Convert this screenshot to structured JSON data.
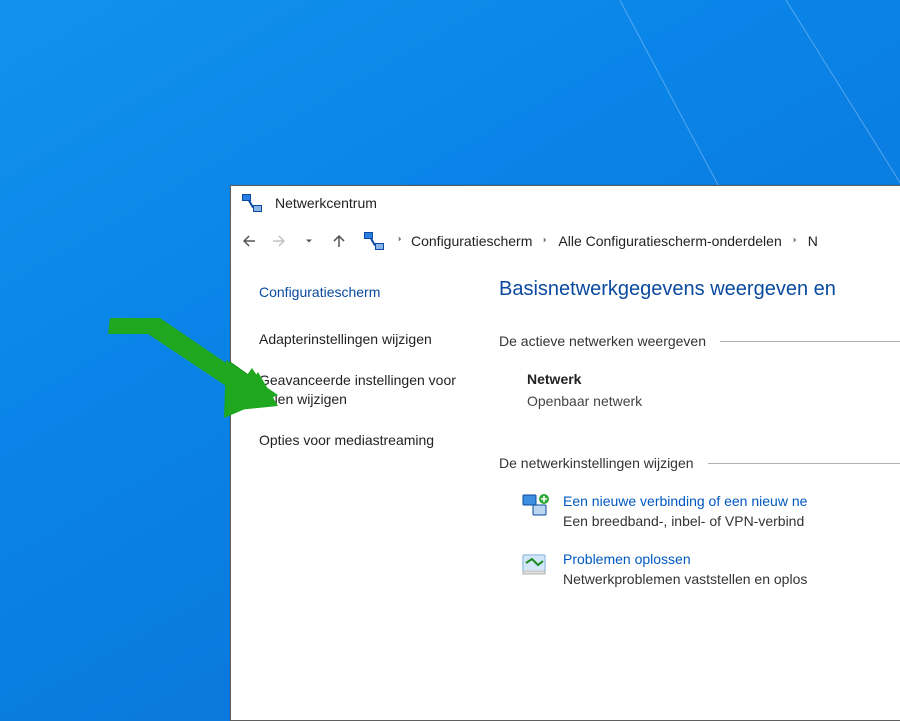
{
  "window": {
    "title": "Netwerkcentrum"
  },
  "breadcrumb": {
    "items": [
      "Configuratiescherm",
      "Alle Configuratiescherm-onderdelen",
      "N"
    ]
  },
  "sidebar": {
    "title": "Configuratiescherm",
    "links": [
      "Adapterinstellingen wijzigen",
      "Geavanceerde instellingen voor delen wijzigen",
      "Opties voor mediastreaming"
    ]
  },
  "main": {
    "heading": "Basisnetwerkgegevens weergeven en",
    "active_networks_header": "De actieve netwerken weergeven",
    "network": {
      "name": "Netwerk",
      "type": "Openbaar netwerk"
    },
    "change_settings_header": "De netwerkinstellingen wijzigen",
    "tasks": [
      {
        "link": "Een nieuwe verbinding of een nieuw ne",
        "desc": "Een breedband-, inbel- of VPN-verbind"
      },
      {
        "link": "Problemen oplossen",
        "desc": "Netwerkproblemen vaststellen en oplos"
      }
    ]
  }
}
